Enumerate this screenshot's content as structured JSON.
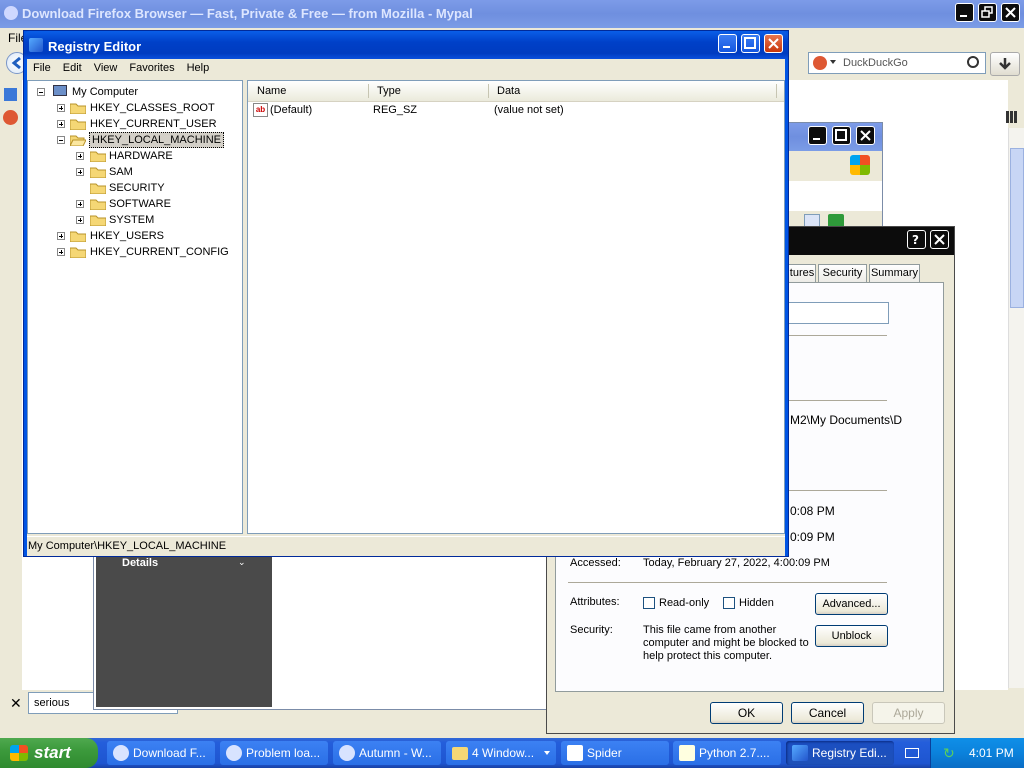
{
  "browser": {
    "title": "Download Firefox Browser — Fast, Private & Free — from Mozilla - Mypal",
    "menu_file": "File",
    "search_engine": "DuckDuckGo",
    "find_query": "serious"
  },
  "explorer_partial": {
    "details_label": "Details"
  },
  "properties": {
    "tabs": [
      "tures",
      "Security",
      "Summary"
    ],
    "location_partial": "M2\\My Documents\\D",
    "created_partial": "0:08 PM",
    "modified_partial": "0:09 PM",
    "accessed_label": "Accessed:",
    "accessed_value": "Today, February 27, 2022, 4:00:09 PM",
    "attributes_label": "Attributes:",
    "readonly_label": "Read-only",
    "hidden_label": "Hidden",
    "advanced_label": "Advanced...",
    "security_label": "Security:",
    "security_text": "This file came from another computer and might be blocked to help protect this computer.",
    "unblock_label": "Unblock",
    "ok_label": "OK",
    "cancel_label": "Cancel",
    "apply_label": "Apply"
  },
  "registry": {
    "title": "Registry Editor",
    "menu": [
      "File",
      "Edit",
      "View",
      "Favorites",
      "Help"
    ],
    "tree_root": "My Computer",
    "hives": [
      "HKEY_CLASSES_ROOT",
      "HKEY_CURRENT_USER",
      "HKEY_LOCAL_MACHINE",
      "HKEY_USERS",
      "HKEY_CURRENT_CONFIG"
    ],
    "hklm_children": [
      "HARDWARE",
      "SAM",
      "SECURITY",
      "SOFTWARE",
      "SYSTEM"
    ],
    "columns": [
      "Name",
      "Type",
      "Data"
    ],
    "rows": [
      {
        "name": "(Default)",
        "type": "REG_SZ",
        "data": "(value not set)"
      }
    ],
    "status": "My Computer\\HKEY_LOCAL_MACHINE"
  },
  "taskbar": {
    "start": "start",
    "buttons": [
      "Download F...",
      "Problem loa...",
      "Autumn - W...",
      "4 Window...",
      "Spider",
      "Python 2.7....",
      "Registry Edi..."
    ],
    "clock": "4:01 PM"
  },
  "colors": {
    "xp_blue": "#0054e3",
    "taskbar_start": "#3c9a3c",
    "tray": "#0f8fe8"
  }
}
